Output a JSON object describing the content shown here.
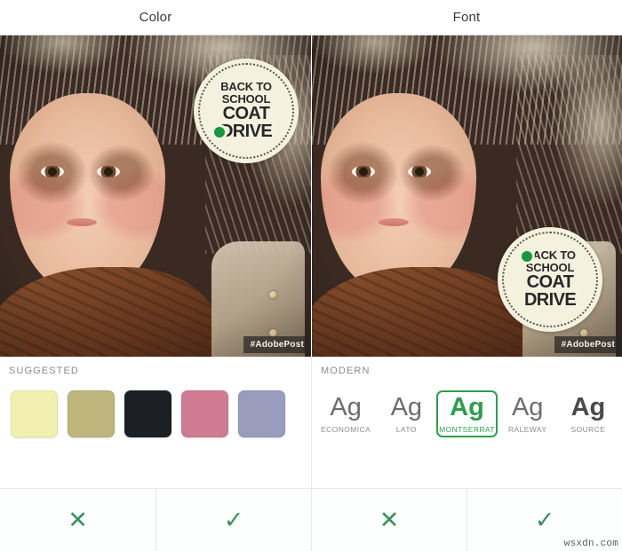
{
  "header": {
    "tabs": [
      {
        "label": "Color",
        "name": "tab-color"
      },
      {
        "label": "Font",
        "name": "tab-font"
      }
    ]
  },
  "previews": [
    {
      "panel": "color",
      "badge": {
        "line1": "BACK TO",
        "line2": "SCHOOL",
        "line3": "COAT",
        "line4": "DRIVE",
        "background": "#F4F2DE",
        "text_color": "#27272A",
        "dot_color": "#179641",
        "position": "top-right"
      },
      "watermark": "#AdobePost"
    },
    {
      "panel": "font",
      "badge": {
        "line1": "BACK TO",
        "line2": "SCHOOL",
        "line3": "COAT",
        "line4": "DRIVE",
        "background": "#F4F2DE",
        "text_color": "#27272A",
        "dot_color": "#179641",
        "position": "bottom-right"
      },
      "watermark": "#AdobePost"
    }
  ],
  "color_panel": {
    "section_label": "SUGGESTED",
    "swatches": [
      {
        "name": "swatch-pale-yellow",
        "hex": "#F2F0B0",
        "selected": false
      },
      {
        "name": "swatch-olive",
        "hex": "#BDB57C",
        "selected": false
      },
      {
        "name": "swatch-near-black",
        "hex": "#1C2024",
        "selected": false
      },
      {
        "name": "swatch-rose-pink",
        "hex": "#CE7B93",
        "selected": false
      },
      {
        "name": "swatch-periwinkle",
        "hex": "#9A9CBE",
        "selected": false
      }
    ]
  },
  "font_panel": {
    "section_label": "MODERN",
    "sample_glyph": "Ag",
    "fonts": [
      {
        "name": "ECONOMICA",
        "weight": "thin",
        "selected": false
      },
      {
        "name": "LATO",
        "weight": "thin",
        "selected": false
      },
      {
        "name": "MONTSERRAT",
        "weight": "bold",
        "selected": true
      },
      {
        "name": "RALEWAY",
        "weight": "thin",
        "selected": false
      },
      {
        "name": "SOURCE",
        "weight": "bold",
        "selected": false
      }
    ],
    "selected_color": "#2E9E4F"
  },
  "actions": {
    "accent_color": "#3C8F5E",
    "buttons": [
      {
        "name": "reject-color-button",
        "glyph": "✕",
        "kind": "reject"
      },
      {
        "name": "accept-color-button",
        "glyph": "✓",
        "kind": "accept"
      },
      {
        "name": "reject-font-button",
        "glyph": "✕",
        "kind": "reject"
      },
      {
        "name": "accept-font-button",
        "glyph": "✓",
        "kind": "accept"
      }
    ]
  },
  "watermark": "wsxdn.com"
}
